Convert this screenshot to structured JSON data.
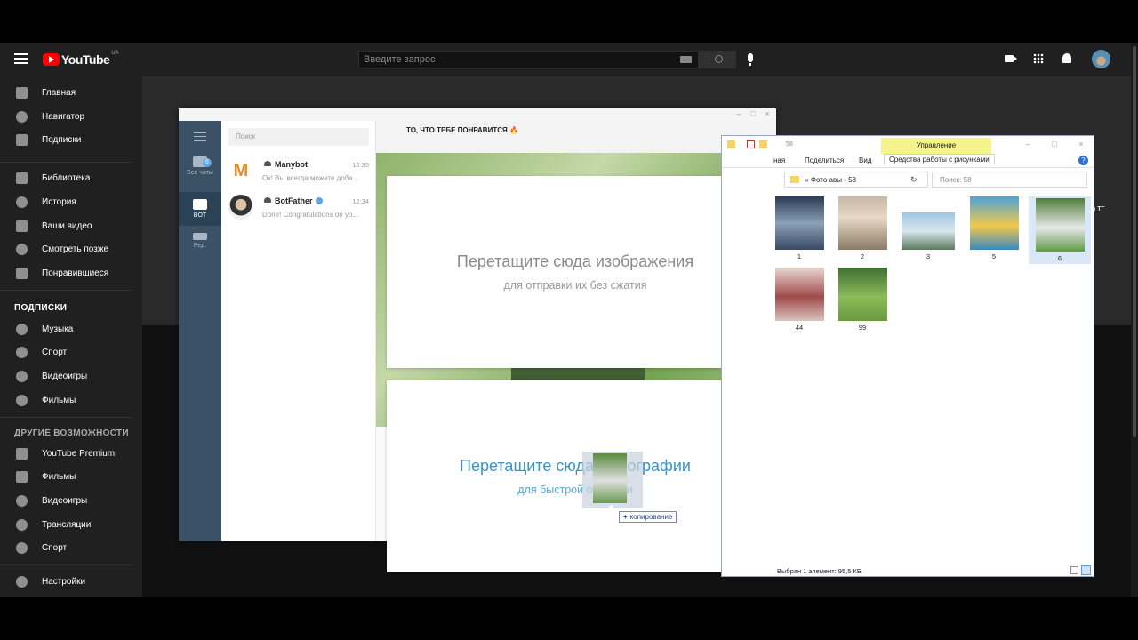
{
  "youtube": {
    "logo_text": "YouTube",
    "region": "UA",
    "search_placeholder": "Введите запрос",
    "sidebar": {
      "items_main": [
        {
          "label": "Главная",
          "icon": "home-icon"
        },
        {
          "label": "Навигатор",
          "icon": "compass-icon"
        },
        {
          "label": "Подписки",
          "icon": "subscriptions-icon"
        }
      ],
      "items_library": [
        {
          "label": "Библиотека",
          "icon": "library-icon"
        },
        {
          "label": "История",
          "icon": "history-icon"
        },
        {
          "label": "Ваши видео",
          "icon": "your-videos-icon"
        },
        {
          "label": "Смотреть позже",
          "icon": "watch-later-icon"
        },
        {
          "label": "Понравившиеся",
          "icon": "thumb-up-icon"
        }
      ],
      "subscriptions_title": "ПОДПИСКИ",
      "subscriptions": [
        {
          "label": "Музыка",
          "icon": "music-icon"
        },
        {
          "label": "Спорт",
          "icon": "sport-icon"
        },
        {
          "label": "Видеоигры",
          "icon": "gaming-icon"
        },
        {
          "label": "Фильмы",
          "icon": "movies-icon"
        }
      ],
      "more_title": "ДРУГИЕ ВОЗМОЖНОСТИ",
      "more": [
        {
          "label": "YouTube Premium",
          "icon": "youtube-icon"
        },
        {
          "label": "Фильмы",
          "icon": "movies-icon"
        },
        {
          "label": "Видеоигры",
          "icon": "gaming-icon"
        },
        {
          "label": "Трансляции",
          "icon": "live-icon"
        },
        {
          "label": "Спорт",
          "icon": "sport-icon"
        }
      ],
      "settings": "Настройки"
    },
    "partial_hint": "в ТГ"
  },
  "telegram": {
    "leftbar": {
      "all_chats": "Все чаты",
      "all_chats_badge": "6",
      "bot": "BOT",
      "edit": "Ред."
    },
    "search_placeholder": "Поиск",
    "chats": [
      {
        "avatar_letter": "M",
        "name": "Manybot",
        "time": "12:35",
        "preview": "Ок! Вы всегда можете доба..."
      },
      {
        "avatar_letter": "",
        "name": "BotFather",
        "time": "12:34",
        "preview": "Done! Congratulations on yo..."
      }
    ],
    "chat_title": "ТО, ЧТО ТЕБЕ ПОНРАВИТСЯ 🔥",
    "drop_images_title": "Перетащите сюда изображения",
    "drop_images_sub": "для отправки их без сжатия",
    "drop_photos_title": "Перетащите сюда фотографии",
    "drop_photos_sub": "для быстрой отправки",
    "copy_tooltip": "копирование",
    "copy_plus": "+"
  },
  "explorer": {
    "title": "58",
    "manage_tab": "Управление",
    "tabs": [
      "ная",
      "Поделиться",
      "Вид",
      "Средства работы с рисунками"
    ],
    "address": [
      "Фото авы",
      "58"
    ],
    "address_sep": "«",
    "search_placeholder": "Поиск: 58",
    "files": [
      {
        "name": "1"
      },
      {
        "name": "2"
      },
      {
        "name": "3"
      },
      {
        "name": "5"
      },
      {
        "name": "6"
      },
      {
        "name": "44"
      },
      {
        "name": "99"
      }
    ],
    "status": "Выбран 1 элемент: 95,5 КБ",
    "help": "?"
  }
}
